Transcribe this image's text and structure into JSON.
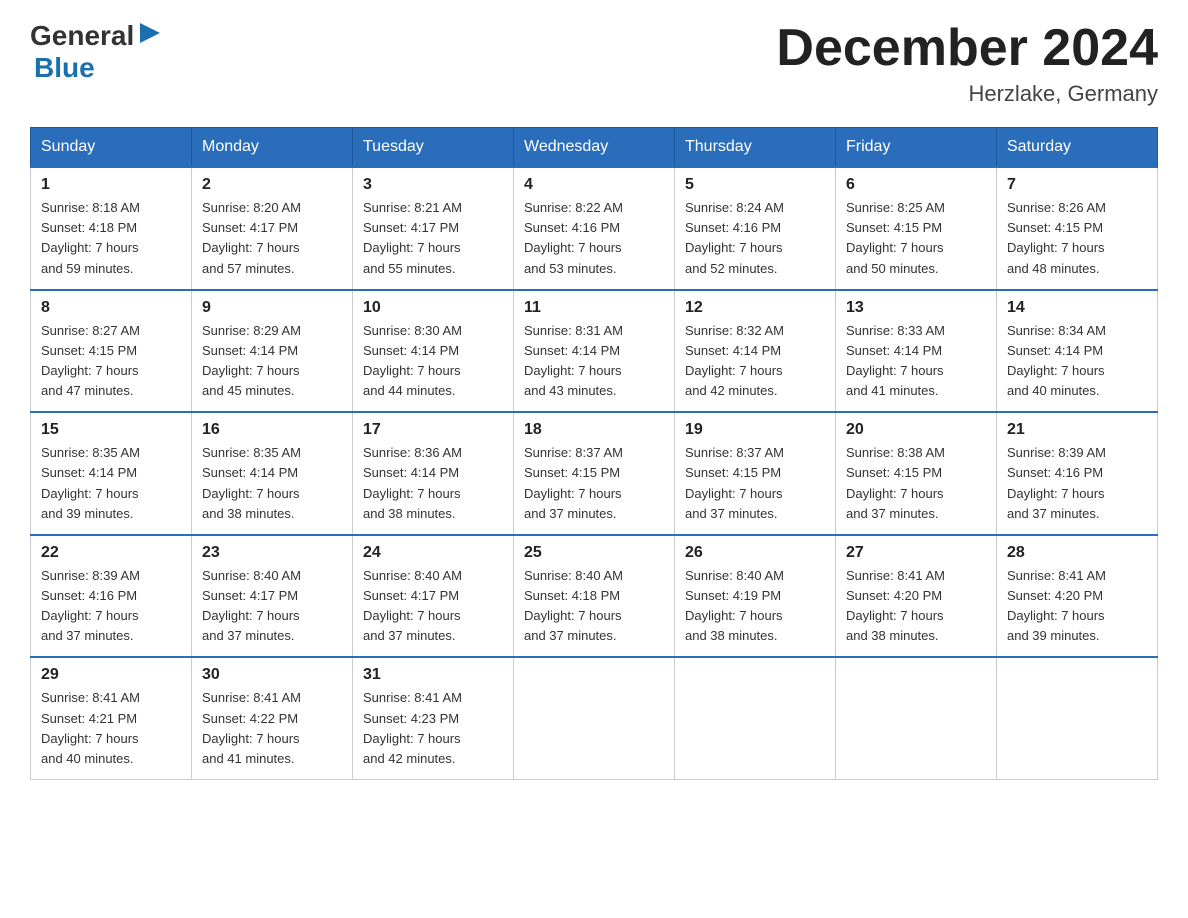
{
  "header": {
    "logo_general": "General",
    "logo_blue": "Blue",
    "month_title": "December 2024",
    "location": "Herzlake, Germany"
  },
  "days_of_week": [
    "Sunday",
    "Monday",
    "Tuesday",
    "Wednesday",
    "Thursday",
    "Friday",
    "Saturday"
  ],
  "weeks": [
    [
      {
        "day": "1",
        "sunrise": "8:18 AM",
        "sunset": "4:18 PM",
        "daylight": "7 hours and 59 minutes."
      },
      {
        "day": "2",
        "sunrise": "8:20 AM",
        "sunset": "4:17 PM",
        "daylight": "7 hours and 57 minutes."
      },
      {
        "day": "3",
        "sunrise": "8:21 AM",
        "sunset": "4:17 PM",
        "daylight": "7 hours and 55 minutes."
      },
      {
        "day": "4",
        "sunrise": "8:22 AM",
        "sunset": "4:16 PM",
        "daylight": "7 hours and 53 minutes."
      },
      {
        "day": "5",
        "sunrise": "8:24 AM",
        "sunset": "4:16 PM",
        "daylight": "7 hours and 52 minutes."
      },
      {
        "day": "6",
        "sunrise": "8:25 AM",
        "sunset": "4:15 PM",
        "daylight": "7 hours and 50 minutes."
      },
      {
        "day": "7",
        "sunrise": "8:26 AM",
        "sunset": "4:15 PM",
        "daylight": "7 hours and 48 minutes."
      }
    ],
    [
      {
        "day": "8",
        "sunrise": "8:27 AM",
        "sunset": "4:15 PM",
        "daylight": "7 hours and 47 minutes."
      },
      {
        "day": "9",
        "sunrise": "8:29 AM",
        "sunset": "4:14 PM",
        "daylight": "7 hours and 45 minutes."
      },
      {
        "day": "10",
        "sunrise": "8:30 AM",
        "sunset": "4:14 PM",
        "daylight": "7 hours and 44 minutes."
      },
      {
        "day": "11",
        "sunrise": "8:31 AM",
        "sunset": "4:14 PM",
        "daylight": "7 hours and 43 minutes."
      },
      {
        "day": "12",
        "sunrise": "8:32 AM",
        "sunset": "4:14 PM",
        "daylight": "7 hours and 42 minutes."
      },
      {
        "day": "13",
        "sunrise": "8:33 AM",
        "sunset": "4:14 PM",
        "daylight": "7 hours and 41 minutes."
      },
      {
        "day": "14",
        "sunrise": "8:34 AM",
        "sunset": "4:14 PM",
        "daylight": "7 hours and 40 minutes."
      }
    ],
    [
      {
        "day": "15",
        "sunrise": "8:35 AM",
        "sunset": "4:14 PM",
        "daylight": "7 hours and 39 minutes."
      },
      {
        "day": "16",
        "sunrise": "8:35 AM",
        "sunset": "4:14 PM",
        "daylight": "7 hours and 38 minutes."
      },
      {
        "day": "17",
        "sunrise": "8:36 AM",
        "sunset": "4:14 PM",
        "daylight": "7 hours and 38 minutes."
      },
      {
        "day": "18",
        "sunrise": "8:37 AM",
        "sunset": "4:15 PM",
        "daylight": "7 hours and 37 minutes."
      },
      {
        "day": "19",
        "sunrise": "8:37 AM",
        "sunset": "4:15 PM",
        "daylight": "7 hours and 37 minutes."
      },
      {
        "day": "20",
        "sunrise": "8:38 AM",
        "sunset": "4:15 PM",
        "daylight": "7 hours and 37 minutes."
      },
      {
        "day": "21",
        "sunrise": "8:39 AM",
        "sunset": "4:16 PM",
        "daylight": "7 hours and 37 minutes."
      }
    ],
    [
      {
        "day": "22",
        "sunrise": "8:39 AM",
        "sunset": "4:16 PM",
        "daylight": "7 hours and 37 minutes."
      },
      {
        "day": "23",
        "sunrise": "8:40 AM",
        "sunset": "4:17 PM",
        "daylight": "7 hours and 37 minutes."
      },
      {
        "day": "24",
        "sunrise": "8:40 AM",
        "sunset": "4:17 PM",
        "daylight": "7 hours and 37 minutes."
      },
      {
        "day": "25",
        "sunrise": "8:40 AM",
        "sunset": "4:18 PM",
        "daylight": "7 hours and 37 minutes."
      },
      {
        "day": "26",
        "sunrise": "8:40 AM",
        "sunset": "4:19 PM",
        "daylight": "7 hours and 38 minutes."
      },
      {
        "day": "27",
        "sunrise": "8:41 AM",
        "sunset": "4:20 PM",
        "daylight": "7 hours and 38 minutes."
      },
      {
        "day": "28",
        "sunrise": "8:41 AM",
        "sunset": "4:20 PM",
        "daylight": "7 hours and 39 minutes."
      }
    ],
    [
      {
        "day": "29",
        "sunrise": "8:41 AM",
        "sunset": "4:21 PM",
        "daylight": "7 hours and 40 minutes."
      },
      {
        "day": "30",
        "sunrise": "8:41 AM",
        "sunset": "4:22 PM",
        "daylight": "7 hours and 41 minutes."
      },
      {
        "day": "31",
        "sunrise": "8:41 AM",
        "sunset": "4:23 PM",
        "daylight": "7 hours and 42 minutes."
      },
      null,
      null,
      null,
      null
    ]
  ],
  "labels": {
    "sunrise": "Sunrise:",
    "sunset": "Sunset:",
    "daylight": "Daylight:"
  }
}
